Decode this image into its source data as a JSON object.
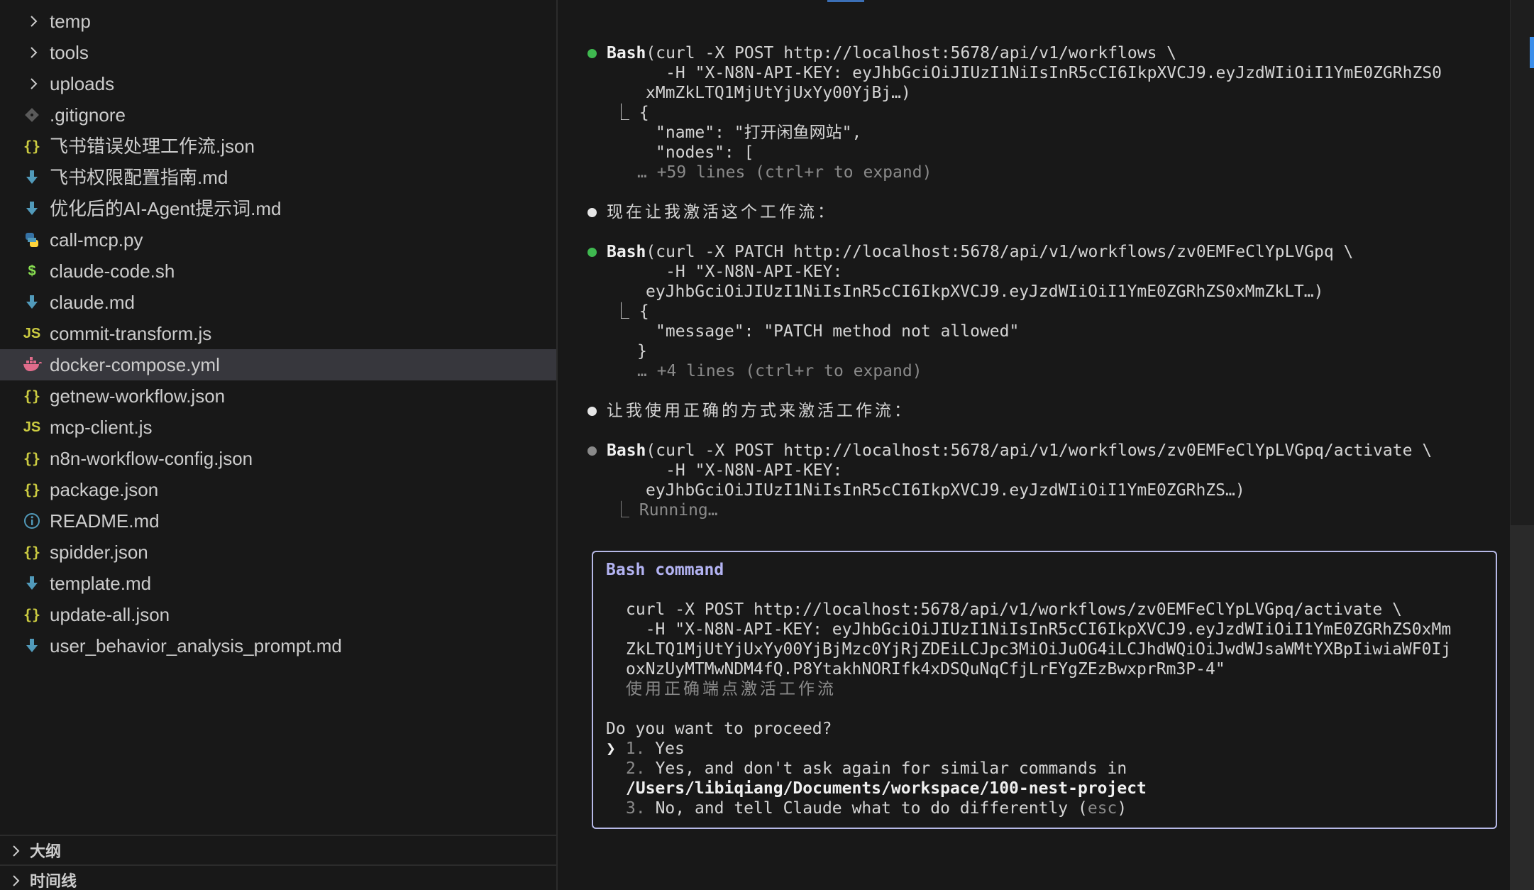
{
  "explorer": {
    "items": [
      {
        "label": "temp",
        "kind": "folder",
        "icon": "chevron-right-icon"
      },
      {
        "label": "tools",
        "kind": "folder",
        "icon": "chevron-right-icon"
      },
      {
        "label": "uploads",
        "kind": "folder",
        "icon": "chevron-right-icon"
      },
      {
        "label": ".gitignore",
        "kind": "file",
        "icon": "git-icon",
        "glyph": "◆"
      },
      {
        "label": "飞书错误处理工作流.json",
        "kind": "file",
        "icon": "json-icon",
        "glyph": "{}"
      },
      {
        "label": "飞书权限配置指南.md",
        "kind": "file",
        "icon": "markdown-icon",
        "glyph": "md"
      },
      {
        "label": "优化后的AI-Agent提示词.md",
        "kind": "file",
        "icon": "markdown-icon",
        "glyph": "md"
      },
      {
        "label": "call-mcp.py",
        "kind": "file",
        "icon": "python-icon",
        "glyph": "py"
      },
      {
        "label": "claude-code.sh",
        "kind": "file",
        "icon": "shell-icon",
        "glyph": "$"
      },
      {
        "label": "claude.md",
        "kind": "file",
        "icon": "markdown-icon",
        "glyph": "md"
      },
      {
        "label": "commit-transform.js",
        "kind": "file",
        "icon": "javascript-icon",
        "glyph": "JS"
      },
      {
        "label": "docker-compose.yml",
        "kind": "file",
        "icon": "docker-icon",
        "glyph": "docker",
        "selected": true
      },
      {
        "label": "getnew-workflow.json",
        "kind": "file",
        "icon": "json-icon",
        "glyph": "{}"
      },
      {
        "label": "mcp-client.js",
        "kind": "file",
        "icon": "javascript-icon",
        "glyph": "JS"
      },
      {
        "label": "n8n-workflow-config.json",
        "kind": "file",
        "icon": "json-icon",
        "glyph": "{}"
      },
      {
        "label": "package.json",
        "kind": "file",
        "icon": "json-icon",
        "glyph": "{}"
      },
      {
        "label": "README.md",
        "kind": "file",
        "icon": "info-icon",
        "glyph": "ⓘ"
      },
      {
        "label": "spidder.json",
        "kind": "file",
        "icon": "json-icon",
        "glyph": "{}"
      },
      {
        "label": "template.md",
        "kind": "file",
        "icon": "markdown-icon",
        "glyph": "md"
      },
      {
        "label": "update-all.json",
        "kind": "file",
        "icon": "json-icon",
        "glyph": "{}"
      },
      {
        "label": "user_behavior_analysis_prompt.md",
        "kind": "file",
        "icon": "markdown-icon",
        "glyph": "md"
      }
    ],
    "panels": [
      {
        "label": "大纲"
      },
      {
        "label": "时间线"
      }
    ]
  },
  "terminal": {
    "block1": {
      "tool": "Bash",
      "line1": "(curl -X POST http://localhost:5678/api/v1/workflows \\",
      "line2": "      -H \"X-N8N-API-KEY: eyJhbGciOiJIUzI1NiIsInR5cCI6IkpXVCJ9.eyJzdWIiOiI1YmE0ZGRhZS0",
      "line3": "xMmZkLTQ1MjUtYjUxYy00YjBj…)",
      "out1": "⎿ {",
      "out2": "\"name\": \"打开闲鱼网站\",",
      "out3": "\"nodes\": [",
      "more": "… +59 lines (ctrl+r to expand)"
    },
    "msg1": "现在让我激活这个工作流：",
    "block2": {
      "tool": "Bash",
      "line1": "(curl -X PATCH http://localhost:5678/api/v1/workflows/zv0EMFeClYpLVGpq \\",
      "line2": "      -H \"X-N8N-API-KEY:",
      "line3": "eyJhbGciOiJIUzI1NiIsInR5cCI6IkpXVCJ9.eyJzdWIiOiI1YmE0ZGRhZS0xMmZkLT…)",
      "out1": "⎿ {",
      "out2": "\"message\": \"PATCH method not allowed\"",
      "out3": "}",
      "more": "… +4 lines (ctrl+r to expand)"
    },
    "msg2": "让我使用正确的方式来激活工作流：",
    "block3": {
      "tool": "Bash",
      "line1": "(curl -X POST http://localhost:5678/api/v1/workflows/zv0EMFeClYpLVGpq/activate \\",
      "line2": "      -H \"X-N8N-API-KEY:",
      "line3": "eyJhbGciOiJIUzI1NiIsInR5cCI6IkpXVCJ9.eyJzdWIiOiI1YmE0ZGRhZS…)",
      "status": "⎿ Running…"
    },
    "prompt_box": {
      "title": "Bash command",
      "cmd1": "curl -X POST http://localhost:5678/api/v1/workflows/zv0EMFeClYpLVGpq/activate \\",
      "cmd2": "  -H \"X-N8N-API-KEY: eyJhbGciOiJIUzI1NiIsInR5cCI6IkpXVCJ9.eyJzdWIiOiI1YmE0ZGRhZS0xMm",
      "cmd3": "ZkLTQ1MjUtYjUxYy00YjBjMzc0YjRjZDEiLCJpc3MiOiJuOG4iLCJhdWQiOiJwdWJsaWMtYXBpIiwiaWF0Ij",
      "cmd4": "oxNzUyMTMwNDM4fQ.P8YtakhNORIfk4xDSQuNqCfjLrEYgZEzBwxprRm3P-4\"",
      "description": "使用正确端点激活工作流",
      "question": "Do you want to proceed?",
      "cursor": "❯",
      "options": [
        {
          "num": "1.",
          "text": "Yes"
        },
        {
          "num": "2.",
          "text": "Yes, and don't ask again for similar commands in"
        },
        {
          "num": "3.",
          "text": "No, and tell Claude what to do differently ("
        }
      ],
      "option2_path": "/Users/libiqiang/Documents/workspace/100-nest-project",
      "option3_key": "esc",
      "option3_close": ")"
    }
  },
  "colors": {
    "background": "#181818",
    "selected_row": "#37373d",
    "dot_success": "#3fb950",
    "prompt_border": "#b6b8e6",
    "prompt_title": "#b3b3f2",
    "json_icon": "#cbcb41",
    "markdown_icon": "#519aba",
    "docker_icon": "#e06c8b"
  }
}
